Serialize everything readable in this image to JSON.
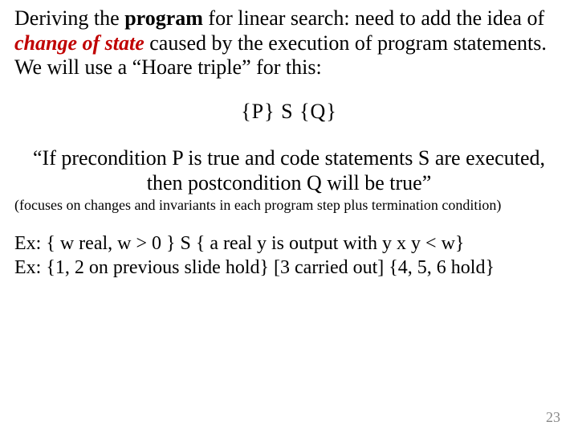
{
  "p1_a": "Deriving the ",
  "p1_b": "program",
  "p1_c": " for linear search: need to add the idea of ",
  "p1_d": "change of state",
  "p1_e": " caused by the execution of program statements.   We will use a “Hoare triple” for this:",
  "triple": "{P}   S   {Q}",
  "quote": "“If precondition P is true and code statements S are executed, then postcondition Q will be true”",
  "note": "(focuses on changes and invariants in each program step plus termination condition)",
  "ex1": "Ex: { w real, w > 0 } S { a real y is output with y x y < w}",
  "ex2": "Ex: {1, 2 on previous slide hold} [3 carried out] {4, 5, 6 hold}",
  "pagenum": "23"
}
